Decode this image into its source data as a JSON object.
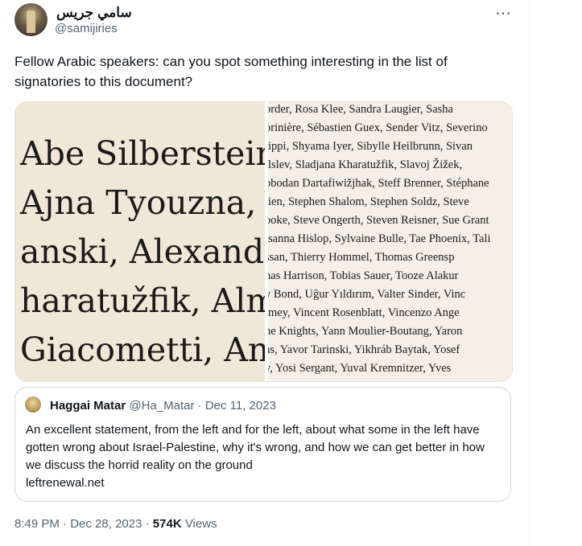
{
  "author": {
    "display_name": "سامي جريس",
    "handle": "@samijiries"
  },
  "more_icon": "⋯",
  "tweet_text": "Fellow Arabic speakers: can you spot something interesting in the list of signatories to this document?",
  "media": {
    "left_zoom_lines": [
      "Abe Silberstein,",
      "Ajna Tyouzna, A",
      "anski, Alexander",
      "haratužfik, Alma",
      "Giacometti, Andr"
    ],
    "right_list_lines": [
      "order, Rosa Klee, Sandra Laugier, Sasha",
      "orinière, Sébastien Guex, Sender Vitz, Severino",
      "lippi, Shyama Iyer, Sibylle Heilbrunn, Sivan",
      "ılslev, Sladjana Kharatužfik, Slavoj Žižek,",
      "obodan Dartafiwižjhak, Steff Brenner, Stéphane",
      "lien, Stephen Shalom, Stephen Soldz, Steve",
      "ooke, Steve Ongerth, Steven Reisner, Sue Grant",
      "ısanna Hislop, Sylvaine Bulle, Tae Phoenix, Tali",
      "ssan, Thierry Hommel, Thomas Greensp",
      "nas Harrison, Tobias Sauer, Tooze Alakur",
      "y Bond, Uğur Yıldırım, Valter Sinder, Vinc",
      "ımey, Vincent Rosenblatt, Vincenzo Ange",
      "ne Knights, Yann Moulier-Boutang, Yaron",
      "as, Yavor Tarinski, Yikhráb Baytak, Yosef",
      "y, Yosi Sergant, Yuval Kremnitzer, Yves"
    ]
  },
  "quoted": {
    "name": "Haggai Matar",
    "handle": "@Ha_Matar",
    "separator": "·",
    "date": "Dec 11, 2023",
    "text": "An excellent statement, from the left and for the left, about what some in the left have gotten wrong about Israel-Palestine, why it's wrong, and how we can get better in how we discuss the horrid reality on the ground",
    "link": "leftrenewal.net"
  },
  "meta": {
    "time": "8:49 PM",
    "sep1": "·",
    "date": "Dec 28, 2023",
    "sep2": "·",
    "views_count": "574K",
    "views_label": "Views"
  }
}
